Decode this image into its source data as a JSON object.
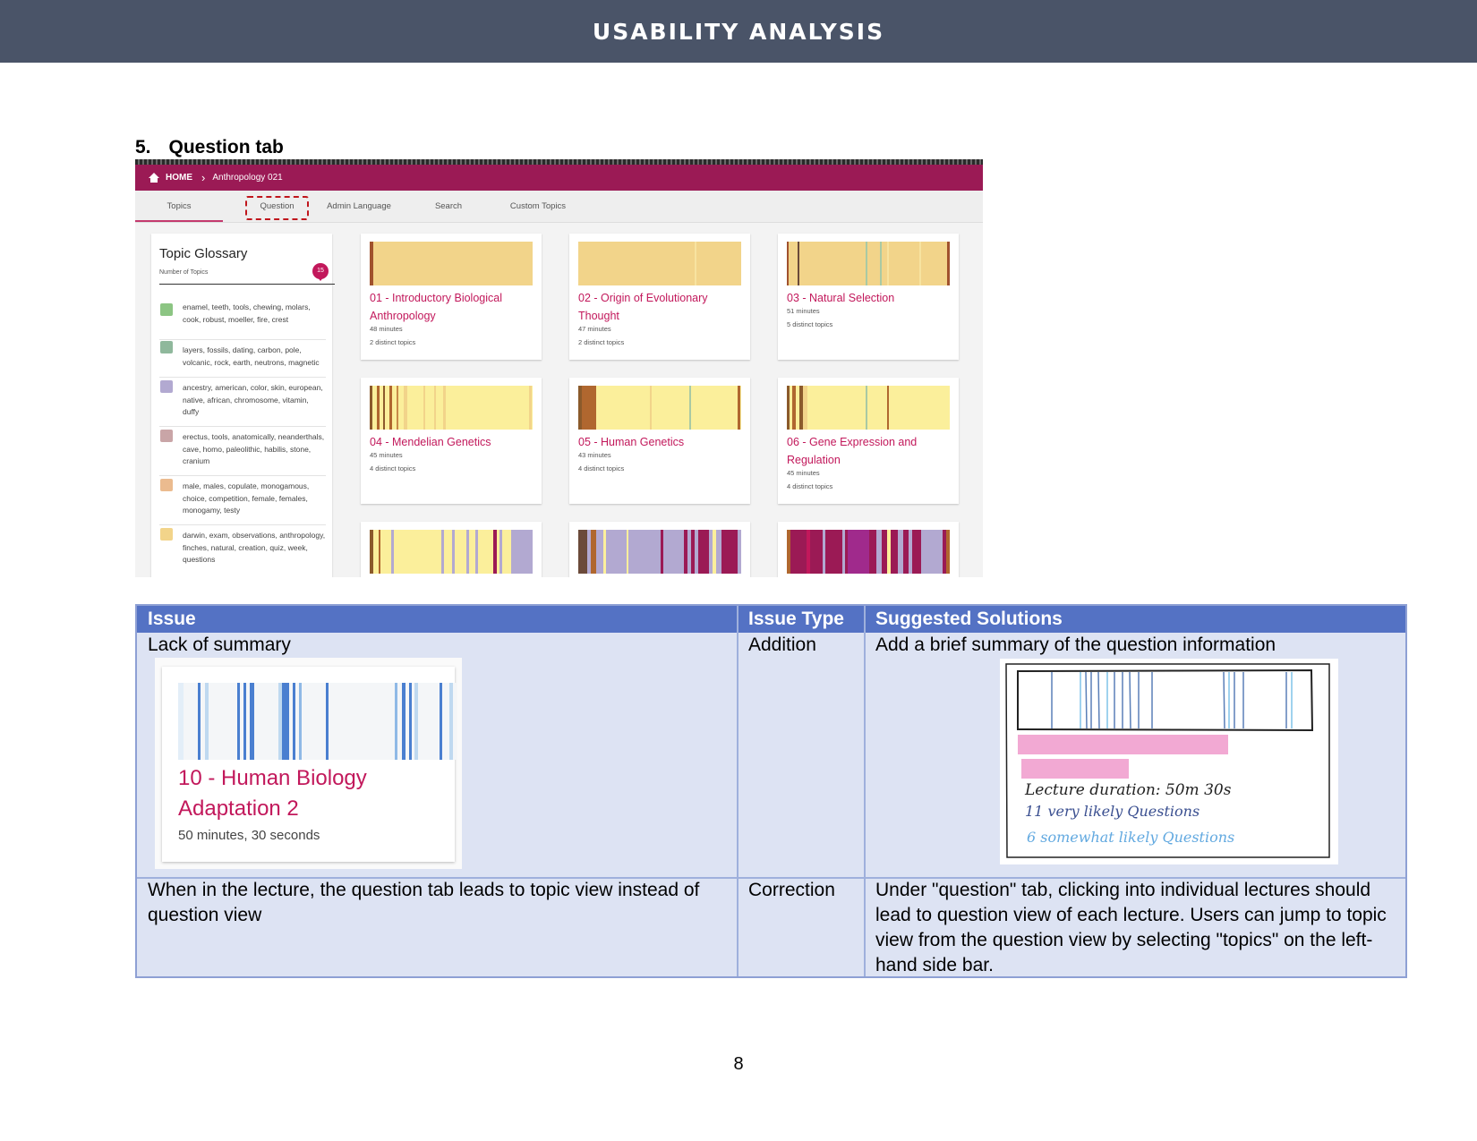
{
  "header": {
    "title": "USABILITY ANALYSIS"
  },
  "section": {
    "number": "5.",
    "title": "Question tab"
  },
  "screenshot": {
    "breadcrumb": {
      "home": "HOME",
      "course": "Anthropology 021"
    },
    "tabs": [
      "Topics",
      "Question",
      "Admin Language",
      "Search",
      "Custom Topics"
    ],
    "glossary": {
      "title": "Topic Glossary",
      "subtitle": "Number of Topics",
      "badge": "15",
      "items": [
        {
          "color": "#8cc583",
          "text": "enamel, teeth, tools, chewing, molars, cook, robust, moeller, fire, crest"
        },
        {
          "color": "#8fb89c",
          "text": "layers, fossils, dating, carbon, pole, volcanic, rock, earth, neutrons, magnetic"
        },
        {
          "color": "#b2a9d1",
          "text": "ancestry, american, color, skin, european, native, african, chromosome, vitamin, duffy"
        },
        {
          "color": "#c9a5a7",
          "text": "erectus, tools, anatomically, neanderthals, cave, homo, paleolithic, habilis, stone, cranium"
        },
        {
          "color": "#ebbb8f",
          "text": "male, males, copulate, monogamous, choice, competition, female, females, monogamy, testy"
        },
        {
          "color": "#f2d48a",
          "text": "darwin, exam, observations, anthropology, finches, natural, creation, quiz, week, questions"
        }
      ]
    },
    "lectures": [
      {
        "title": "01 - Introductory Biological Anthropology",
        "duration": "48 minutes",
        "topics": "2 distinct topics"
      },
      {
        "title": "02 - Origin of Evolutionary Thought",
        "duration": "47 minutes",
        "topics": "2 distinct topics"
      },
      {
        "title": "03 - Natural Selection",
        "duration": "51 minutes",
        "topics": "5 distinct topics"
      },
      {
        "title": "04 - Mendelian Genetics",
        "duration": "45 minutes",
        "topics": "4 distinct topics"
      },
      {
        "title": "05 - Human Genetics",
        "duration": "43 minutes",
        "topics": "4 distinct topics"
      },
      {
        "title": "06 - Gene Expression and Regulation",
        "duration": "45 minutes",
        "topics": "4 distinct topics"
      }
    ]
  },
  "table": {
    "headers": {
      "issue": "Issue",
      "type": "Issue Type",
      "solution": "Suggested Solutions"
    },
    "rows": [
      {
        "issue": "Lack of summary",
        "type": "Addition",
        "solution": "Add a brief summary of the question information",
        "thumb": {
          "title": "10 - Human Biology Adaptation 2",
          "meta": "50 minutes, 30 seconds"
        },
        "sketch": {
          "line1": "Lecture duration: 50m 30s",
          "line2": "11 very likely Questions",
          "line3": "6 somewhat likely Questions"
        }
      },
      {
        "issue": "When in the lecture, the question tab leads to topic view instead of question view",
        "type": "Correction",
        "solution": "Under \"question\" tab, clicking into individual lectures should lead to question view of each lecture. Users can jump to topic view from the question view by selecting \"topics\" on the left-hand side bar."
      }
    ]
  },
  "footer": {
    "page": "8"
  }
}
